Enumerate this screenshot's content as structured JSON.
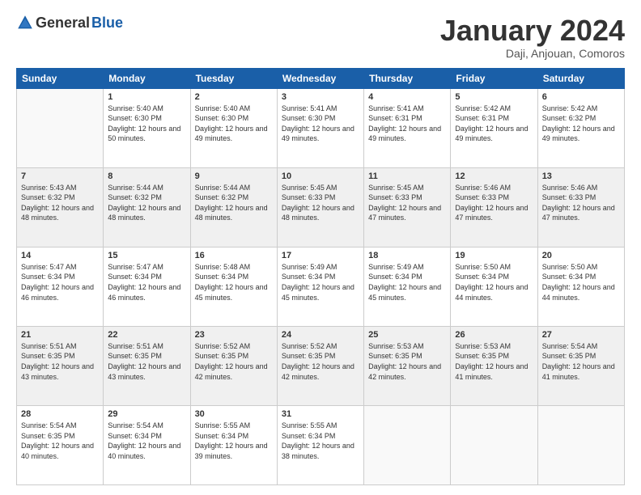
{
  "header": {
    "logo_general": "General",
    "logo_blue": "Blue",
    "month_title": "January 2024",
    "subtitle": "Daji, Anjouan, Comoros"
  },
  "weekdays": [
    "Sunday",
    "Monday",
    "Tuesday",
    "Wednesday",
    "Thursday",
    "Friday",
    "Saturday"
  ],
  "weeks": [
    [
      {
        "day": "",
        "info": ""
      },
      {
        "day": "1",
        "info": "Sunrise: 5:40 AM\nSunset: 6:30 PM\nDaylight: 12 hours\nand 50 minutes."
      },
      {
        "day": "2",
        "info": "Sunrise: 5:40 AM\nSunset: 6:30 PM\nDaylight: 12 hours\nand 49 minutes."
      },
      {
        "day": "3",
        "info": "Sunrise: 5:41 AM\nSunset: 6:30 PM\nDaylight: 12 hours\nand 49 minutes."
      },
      {
        "day": "4",
        "info": "Sunrise: 5:41 AM\nSunset: 6:31 PM\nDaylight: 12 hours\nand 49 minutes."
      },
      {
        "day": "5",
        "info": "Sunrise: 5:42 AM\nSunset: 6:31 PM\nDaylight: 12 hours\nand 49 minutes."
      },
      {
        "day": "6",
        "info": "Sunrise: 5:42 AM\nSunset: 6:32 PM\nDaylight: 12 hours\nand 49 minutes."
      }
    ],
    [
      {
        "day": "7",
        "info": "Sunrise: 5:43 AM\nSunset: 6:32 PM\nDaylight: 12 hours\nand 48 minutes."
      },
      {
        "day": "8",
        "info": "Sunrise: 5:44 AM\nSunset: 6:32 PM\nDaylight: 12 hours\nand 48 minutes."
      },
      {
        "day": "9",
        "info": "Sunrise: 5:44 AM\nSunset: 6:32 PM\nDaylight: 12 hours\nand 48 minutes."
      },
      {
        "day": "10",
        "info": "Sunrise: 5:45 AM\nSunset: 6:33 PM\nDaylight: 12 hours\nand 48 minutes."
      },
      {
        "day": "11",
        "info": "Sunrise: 5:45 AM\nSunset: 6:33 PM\nDaylight: 12 hours\nand 47 minutes."
      },
      {
        "day": "12",
        "info": "Sunrise: 5:46 AM\nSunset: 6:33 PM\nDaylight: 12 hours\nand 47 minutes."
      },
      {
        "day": "13",
        "info": "Sunrise: 5:46 AM\nSunset: 6:33 PM\nDaylight: 12 hours\nand 47 minutes."
      }
    ],
    [
      {
        "day": "14",
        "info": "Sunrise: 5:47 AM\nSunset: 6:34 PM\nDaylight: 12 hours\nand 46 minutes."
      },
      {
        "day": "15",
        "info": "Sunrise: 5:47 AM\nSunset: 6:34 PM\nDaylight: 12 hours\nand 46 minutes."
      },
      {
        "day": "16",
        "info": "Sunrise: 5:48 AM\nSunset: 6:34 PM\nDaylight: 12 hours\nand 45 minutes."
      },
      {
        "day": "17",
        "info": "Sunrise: 5:49 AM\nSunset: 6:34 PM\nDaylight: 12 hours\nand 45 minutes."
      },
      {
        "day": "18",
        "info": "Sunrise: 5:49 AM\nSunset: 6:34 PM\nDaylight: 12 hours\nand 45 minutes."
      },
      {
        "day": "19",
        "info": "Sunrise: 5:50 AM\nSunset: 6:34 PM\nDaylight: 12 hours\nand 44 minutes."
      },
      {
        "day": "20",
        "info": "Sunrise: 5:50 AM\nSunset: 6:34 PM\nDaylight: 12 hours\nand 44 minutes."
      }
    ],
    [
      {
        "day": "21",
        "info": "Sunrise: 5:51 AM\nSunset: 6:35 PM\nDaylight: 12 hours\nand 43 minutes."
      },
      {
        "day": "22",
        "info": "Sunrise: 5:51 AM\nSunset: 6:35 PM\nDaylight: 12 hours\nand 43 minutes."
      },
      {
        "day": "23",
        "info": "Sunrise: 5:52 AM\nSunset: 6:35 PM\nDaylight: 12 hours\nand 42 minutes."
      },
      {
        "day": "24",
        "info": "Sunrise: 5:52 AM\nSunset: 6:35 PM\nDaylight: 12 hours\nand 42 minutes."
      },
      {
        "day": "25",
        "info": "Sunrise: 5:53 AM\nSunset: 6:35 PM\nDaylight: 12 hours\nand 42 minutes."
      },
      {
        "day": "26",
        "info": "Sunrise: 5:53 AM\nSunset: 6:35 PM\nDaylight: 12 hours\nand 41 minutes."
      },
      {
        "day": "27",
        "info": "Sunrise: 5:54 AM\nSunset: 6:35 PM\nDaylight: 12 hours\nand 41 minutes."
      }
    ],
    [
      {
        "day": "28",
        "info": "Sunrise: 5:54 AM\nSunset: 6:35 PM\nDaylight: 12 hours\nand 40 minutes."
      },
      {
        "day": "29",
        "info": "Sunrise: 5:54 AM\nSunset: 6:34 PM\nDaylight: 12 hours\nand 40 minutes."
      },
      {
        "day": "30",
        "info": "Sunrise: 5:55 AM\nSunset: 6:34 PM\nDaylight: 12 hours\nand 39 minutes."
      },
      {
        "day": "31",
        "info": "Sunrise: 5:55 AM\nSunset: 6:34 PM\nDaylight: 12 hours\nand 38 minutes."
      },
      {
        "day": "",
        "info": ""
      },
      {
        "day": "",
        "info": ""
      },
      {
        "day": "",
        "info": ""
      }
    ]
  ]
}
